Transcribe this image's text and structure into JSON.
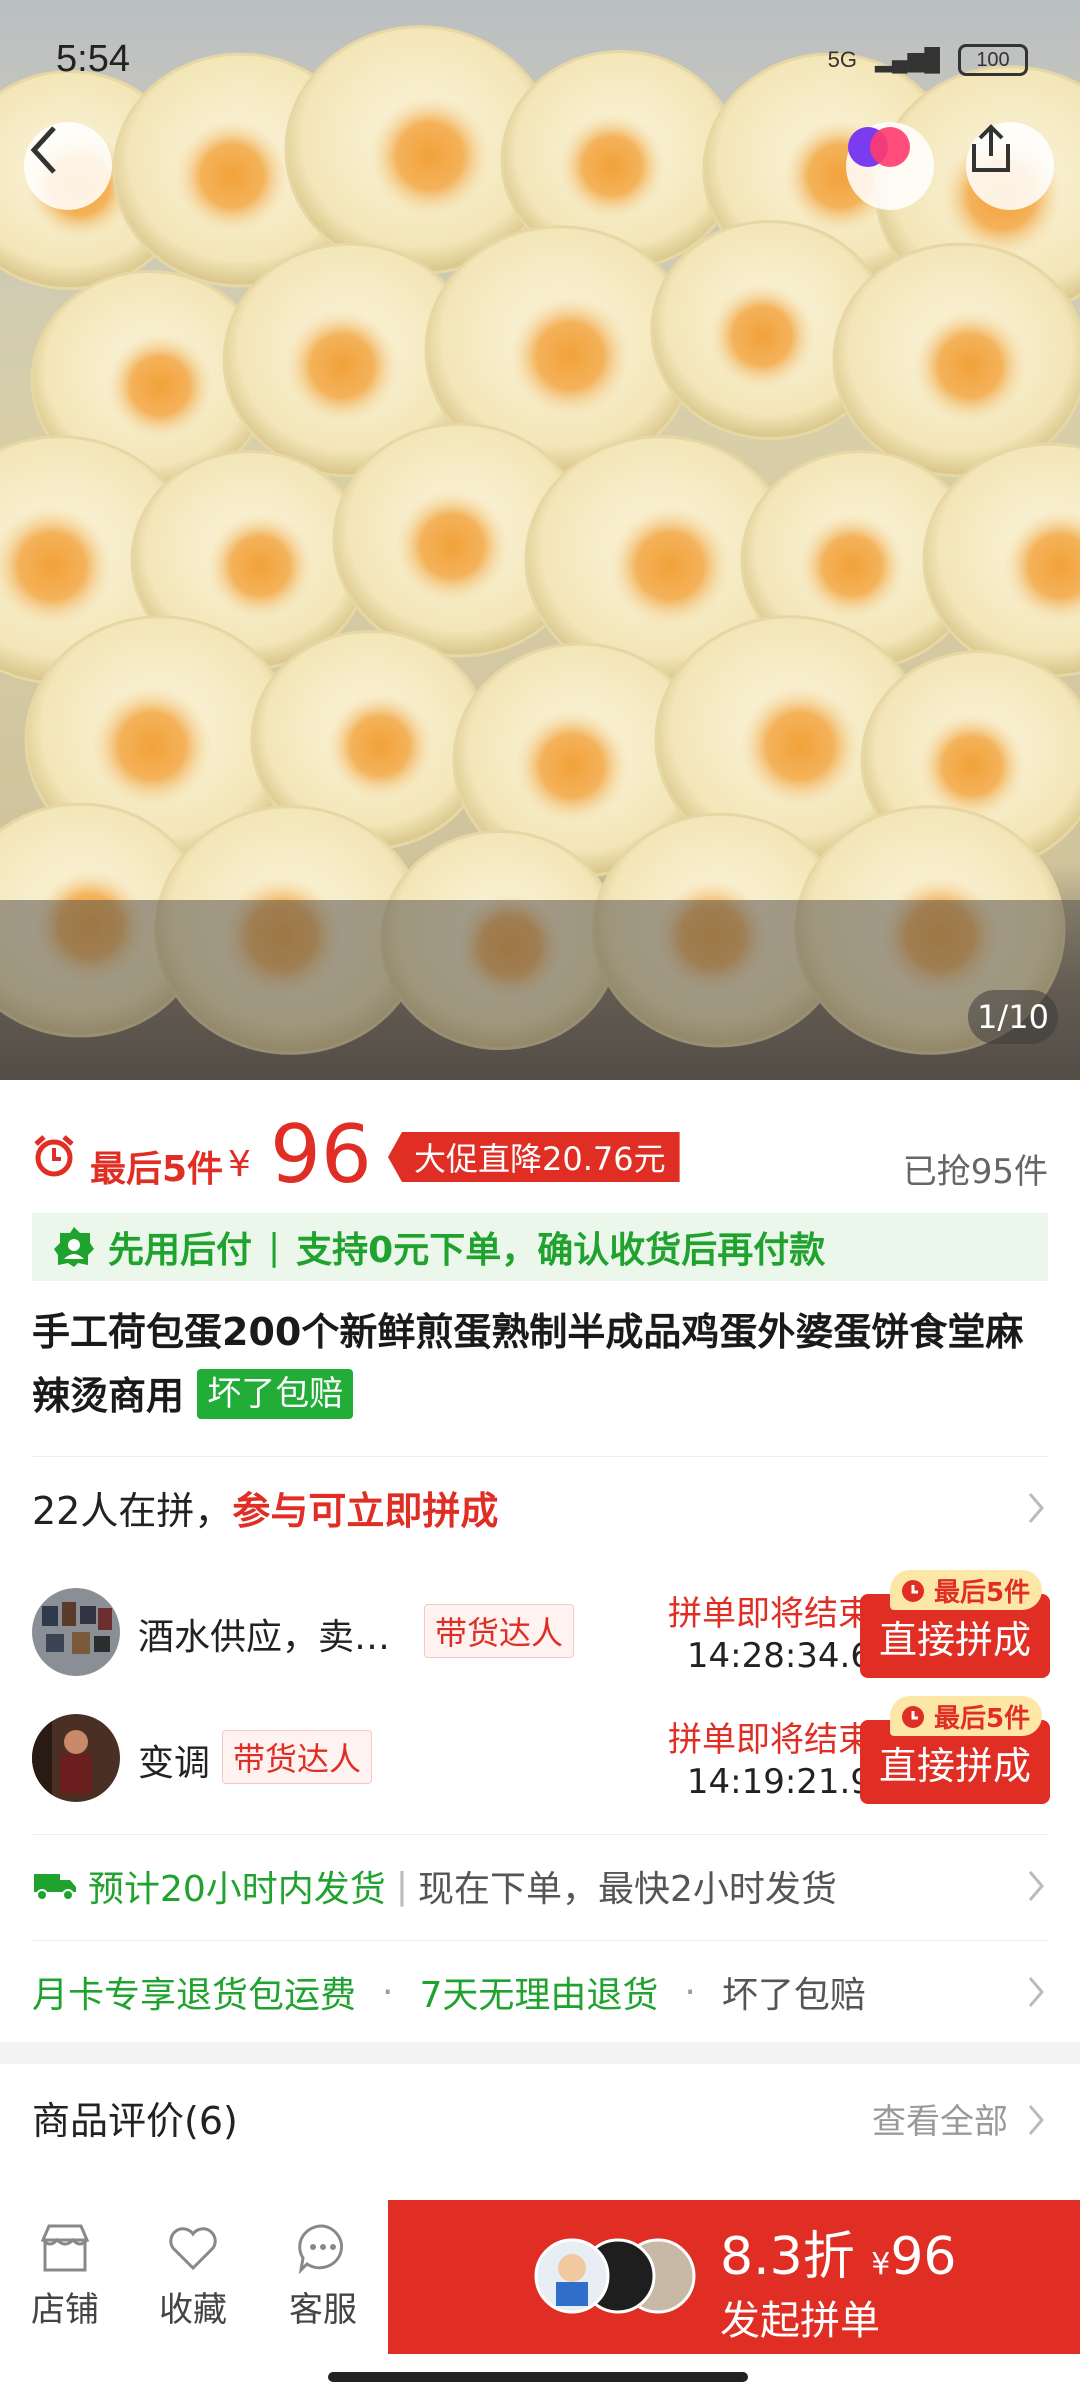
{
  "status": {
    "time": "5:54",
    "network": "5G",
    "battery": "100"
  },
  "hero": {
    "pager": "1/10"
  },
  "price": {
    "last_pieces": "最后5件",
    "yen": "¥",
    "amount": "96",
    "promo": "大促直降20.76元",
    "grabbed": "已抢95件"
  },
  "payline": {
    "part1": "先用后付",
    "sep": "|",
    "part2": "支持0元下单，确认收货后再付款"
  },
  "product": {
    "title": "手工荷包蛋200个新鲜煎蛋熟制半成品鸡蛋外婆蛋饼食堂麻辣烫商用",
    "tag": "坏了包赔"
  },
  "group": {
    "count_text": "22人在拼，",
    "join_text": "参与可立即拼成",
    "items": [
      {
        "name": "酒水供应，卖…",
        "tag": "带货达人",
        "status": "拼单即将结束",
        "countdown": "14:28:34.6",
        "badge": "最后5件",
        "button": "直接拼成"
      },
      {
        "name": "变调",
        "tag": "带货达人",
        "status": "拼单即将结束",
        "countdown": "14:19:21.9",
        "badge": "最后5件",
        "button": "直接拼成"
      }
    ]
  },
  "shipping": {
    "main": "预计20小时内发货",
    "sep": "|",
    "detail": "现在下单，最快2小时发货"
  },
  "service": {
    "item1": "月卡专享退货包运费",
    "dot": "·",
    "item2": "7天无理由退货",
    "item3": "坏了包赔"
  },
  "reviews": {
    "title": "商品评价(6)",
    "view_all": "查看全部"
  },
  "bottom": {
    "store": "店铺",
    "favorite": "收藏",
    "service": "客服",
    "discount": "8.3折",
    "yen": "¥",
    "price": "96",
    "action": "发起拼单"
  },
  "colors": {
    "accent": "#e02e24",
    "green": "#1fa22e"
  }
}
